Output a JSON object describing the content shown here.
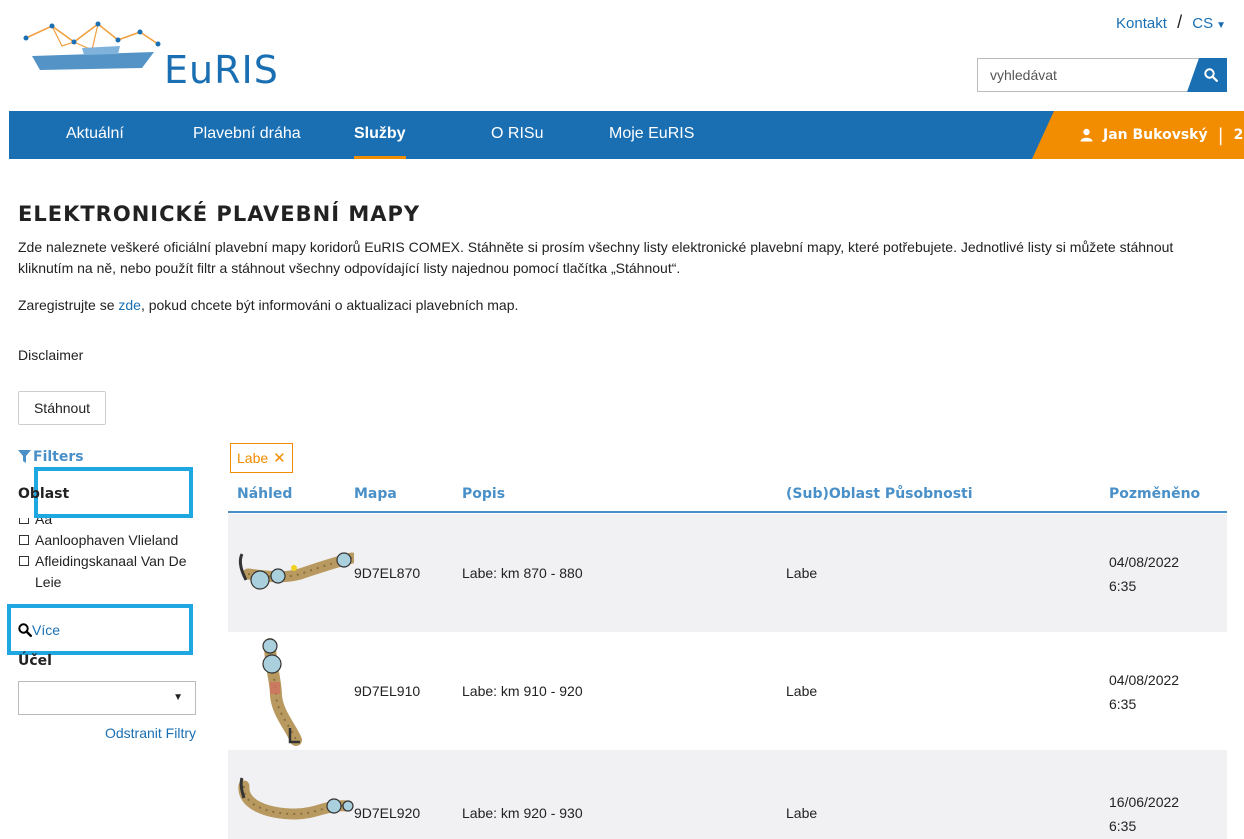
{
  "header": {
    "logo_text": "EuRIS",
    "contact_label": "Kontakt",
    "separator": "/",
    "language": "CS",
    "search_placeholder": "vyhledávat"
  },
  "nav": {
    "items": [
      {
        "label": "Aktuální"
      },
      {
        "label": "Plavební dráha"
      },
      {
        "label": "Služby"
      },
      {
        "label": "O RISu"
      },
      {
        "label": "Moje EuRIS"
      }
    ],
    "active": "Služby",
    "user_name": "Jan Bukovský",
    "notification_count": "2"
  },
  "page": {
    "title": "ELEKTRONICKÉ PLAVEBNÍ MAPY",
    "intro": "Zde naleznete veškeré oficiální plavební mapy koridorů EuRIS COMEX. Stáhněte si prosím všechny listy elektronické plavební mapy, které potřebujete. Jednotlivé listy si můžete stáhnout kliknutím na ně, nebo použít filtr a stáhnout všechny odpovídající listy najednou pomocí tlačítka „Stáhnout“.",
    "register_prefix": "Zaregistrujte se ",
    "register_link": "zde",
    "register_suffix": ", pokud chcete být informováni o aktualizaci plavebních map.",
    "disclaimer": "Disclaimer",
    "download_button": "Stáhnout"
  },
  "filters": {
    "title": "Filters",
    "region_label": "Oblast",
    "regions": [
      {
        "label": "Aa"
      },
      {
        "label": "Aanloophaven Vlieland"
      },
      {
        "label": "Afleidingskanaal Van De Leie"
      }
    ],
    "more_label": "Více",
    "purpose_label": "Účel",
    "purpose_value": "",
    "remove_label": "Odstranit Filtry"
  },
  "table": {
    "active_tag": "Labe",
    "headers": {
      "preview": "Náhled",
      "map": "Mapa",
      "description": "Popis",
      "area": "(Sub)Oblast Působnosti",
      "modified": "Pozměněno"
    },
    "rows": [
      {
        "map": "9D7EL870",
        "description": "Labe: km 870 - 880",
        "area": "Labe",
        "date": "04/08/2022",
        "time": "6:35"
      },
      {
        "map": "9D7EL910",
        "description": "Labe: km 910 - 920",
        "area": "Labe",
        "date": "04/08/2022",
        "time": "6:35"
      },
      {
        "map": "9D7EL920",
        "description": "Labe: km 920 - 930",
        "area": "Labe",
        "date": "16/06/2022",
        "time": "6:35"
      }
    ]
  },
  "colors": {
    "primary": "#1a6fb3",
    "accent": "#f28c00",
    "highlight": "#1ea7e1",
    "row_alt": "#f1f1f4"
  }
}
